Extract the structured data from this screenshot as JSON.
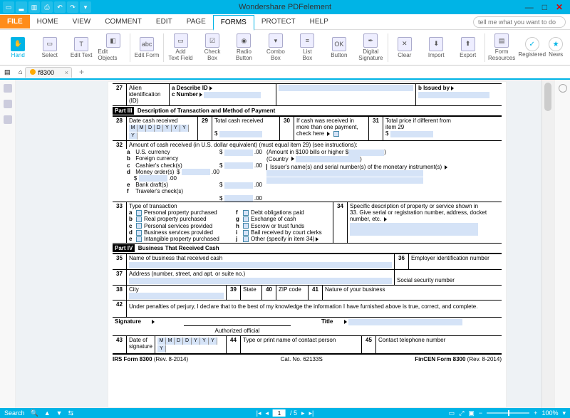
{
  "app": {
    "title": "Wondershare PDFelement"
  },
  "winctrl": {
    "min": "—",
    "max": "□",
    "close": "✕"
  },
  "menu": {
    "file": "FILE",
    "items": [
      "HOME",
      "VIEW",
      "COMMENT",
      "EDIT",
      "PAGE",
      "FORMS",
      "PROTECT",
      "HELP"
    ],
    "active": "FORMS",
    "search_placeholder": "tell me what you want to do"
  },
  "ribbon": {
    "hand": "Hand",
    "select": "Select",
    "edit_text": "Edit Text",
    "edit_objects": "Edit Objects",
    "edit_form": "Edit Form",
    "add_text_field": "Add\nText Field",
    "check_box": "Check\nBox",
    "radio_button": "Radio\nButton",
    "combo_box": "Combo\nBox",
    "list_box": "List\nBox",
    "button": "Button",
    "digital_signature": "Digital\nSignature",
    "clear": "Clear",
    "import": "Import",
    "export": "Export",
    "form_resources": "Form\nResources",
    "registered": "Registered",
    "news": "News"
  },
  "tabs": {
    "name": "f8300",
    "plus": "+"
  },
  "form": {
    "r27_num": "27",
    "r27_a": "Alien",
    "r27_b": "identification (ID)",
    "r27_desc": "a  Describe ID",
    "r27_cnum": "c  Number",
    "r27_issued": "b  Issued by",
    "part3_tag": "Part III",
    "part3_title": "Description of Transaction and Method of Payment",
    "r28_num": "28",
    "r28_label": "Date cash received",
    "r28_hdrs": [
      "M",
      "M",
      "D",
      "D",
      "Y",
      "Y",
      "Y",
      "Y"
    ],
    "r29_num": "29",
    "r29_label": "Total cash received",
    "r29_dollar": "$",
    "r30_num": "30",
    "r30_a": "If cash was received in",
    "r30_b": "more than one payment,",
    "r30_c": "check here",
    "r31_num": "31",
    "r31_a": "Total price if different from",
    "r31_b": "item 29",
    "r31_dollar": "$",
    "r32_num": "32",
    "r32_label": "Amount of cash received (in U.S. dollar equivalent) (must equal item 29) (see instructions):",
    "r32_items": [
      {
        "k": "a",
        "t": "U.S. currency",
        "d": ".00"
      },
      {
        "k": "b",
        "t": "Foreign currency",
        "d": ".00"
      },
      {
        "k": "c",
        "t": "Cashier's check(s)",
        "d": ".00"
      },
      {
        "k": "d",
        "t": "Money order(s)",
        "d": ".00"
      },
      {
        "k": "e",
        "t": "Bank draft(s)",
        "d": ".00"
      },
      {
        "k": "f",
        "t": "Traveler's check(s)",
        "d": ".00"
      }
    ],
    "r32_side1": "(Amount in $100 bills or higher $",
    "r32_side1b": ")",
    "r32_side2": "(Country",
    "r32_side2b": ")",
    "r32_side3": "Issuer's name(s) and serial number(s) of the monetary instrument(s)",
    "r33_num": "33",
    "r33_label": "Type of transaction",
    "r33_left": [
      {
        "k": "a",
        "t": "Personal property purchased"
      },
      {
        "k": "b",
        "t": "Real property purchased"
      },
      {
        "k": "c",
        "t": "Personal services provided"
      },
      {
        "k": "d",
        "t": "Business services provided"
      },
      {
        "k": "e",
        "t": "Intangible property purchased"
      }
    ],
    "r33_right": [
      {
        "k": "f",
        "t": "Debt obligations paid"
      },
      {
        "k": "g",
        "t": "Exchange of cash"
      },
      {
        "k": "h",
        "t": "Escrow or trust funds"
      },
      {
        "k": "i",
        "t": "Bail received by court clerks"
      },
      {
        "k": "j",
        "t": "Other (specify in item 34)"
      }
    ],
    "r34_num": "34",
    "r34_a": "Specific description of property or service shown in",
    "r34_b": "33. Give serial or registration number, address, docket",
    "r34_c": "number, etc.",
    "part4_tag": "Part IV",
    "part4_title": "Business That Received Cash",
    "r35_num": "35",
    "r35_label": "Name of business that received cash",
    "r36_num": "36",
    "r36_label": "Employer identification number",
    "r37_num": "37",
    "r37_label": "Address (number, street, and apt. or suite no.)",
    "r37_ssn": "Social security number",
    "r38_num": "38",
    "r38_label": "City",
    "r39_num": "39",
    "r39_label": "State",
    "r40_num": "40",
    "r40_label": "ZIP code",
    "r41_num": "41",
    "r41_label": "Nature of your business",
    "r42_num": "42",
    "r42_text": "Under penalties of perjury, I declare that to the best of my knowledge the information I have furnished above is true, correct, and complete.",
    "sig": "Signature",
    "auth": "Authorized official",
    "title": "Title",
    "r43_num": "43",
    "r43_label": "Date of\nsignature",
    "r43_hdrs": [
      "M",
      "M",
      "D",
      "D",
      "Y",
      "Y",
      "Y",
      "Y"
    ],
    "r44_num": "44",
    "r44_label": "Type or print name of contact person",
    "r45_num": "45",
    "r45_label": "Contact telephone number",
    "foot_l": "IRS Form 8300",
    "foot_l2": "(Rev. 8-2014)",
    "foot_c": "Cat. No. 62133S",
    "foot_r": "FinCEN Form 8300",
    "foot_r2": "(Rev. 8-2014)"
  },
  "status": {
    "search": "Search",
    "page": "1",
    "total": "/ 5",
    "zoom": "100%"
  }
}
